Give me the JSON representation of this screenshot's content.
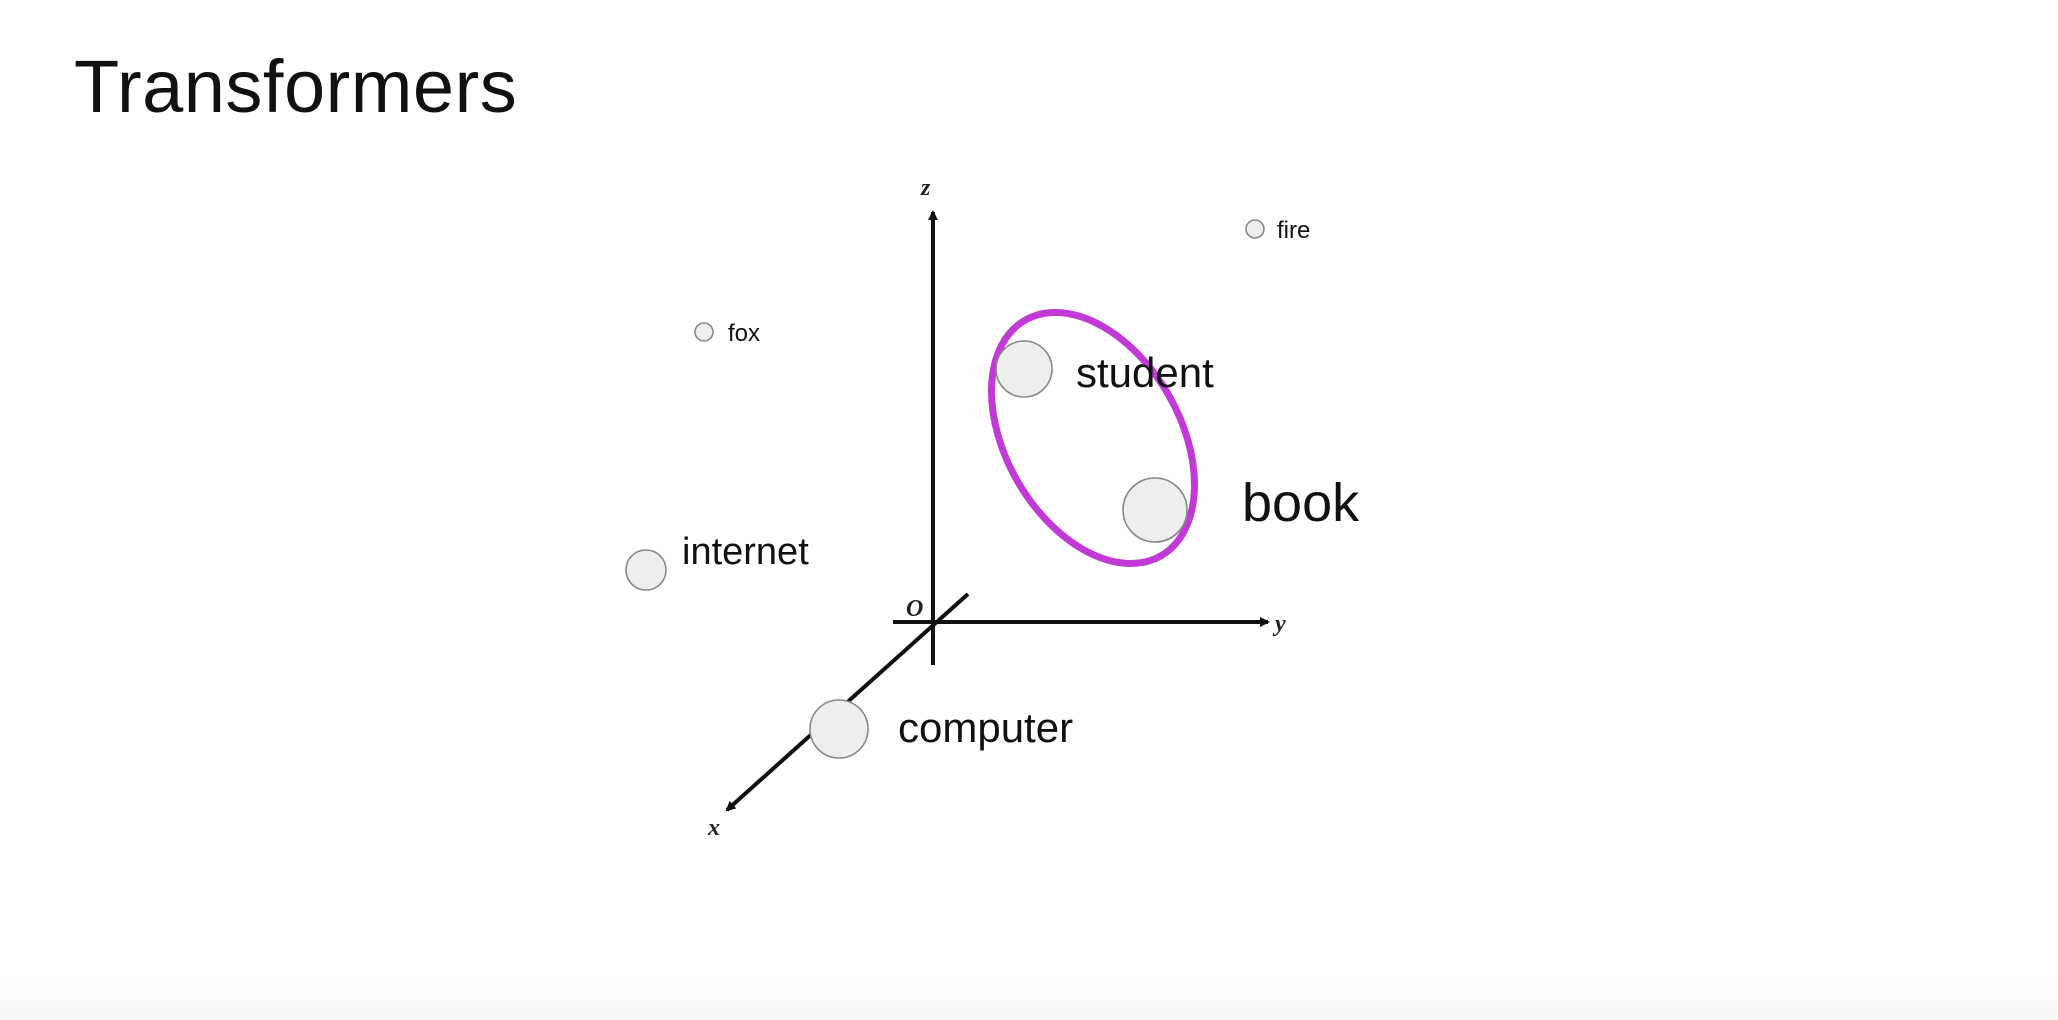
{
  "slide": {
    "title": "Transformers"
  },
  "axes": {
    "z_label": "z",
    "y_label": "y",
    "x_label": "x",
    "origin_label": "O"
  },
  "words": {
    "fire": "fire",
    "fox": "fox",
    "student": "student",
    "book": "book",
    "internet": "internet",
    "computer": "computer"
  },
  "colors": {
    "cluster_highlight": "#c23ad6"
  }
}
